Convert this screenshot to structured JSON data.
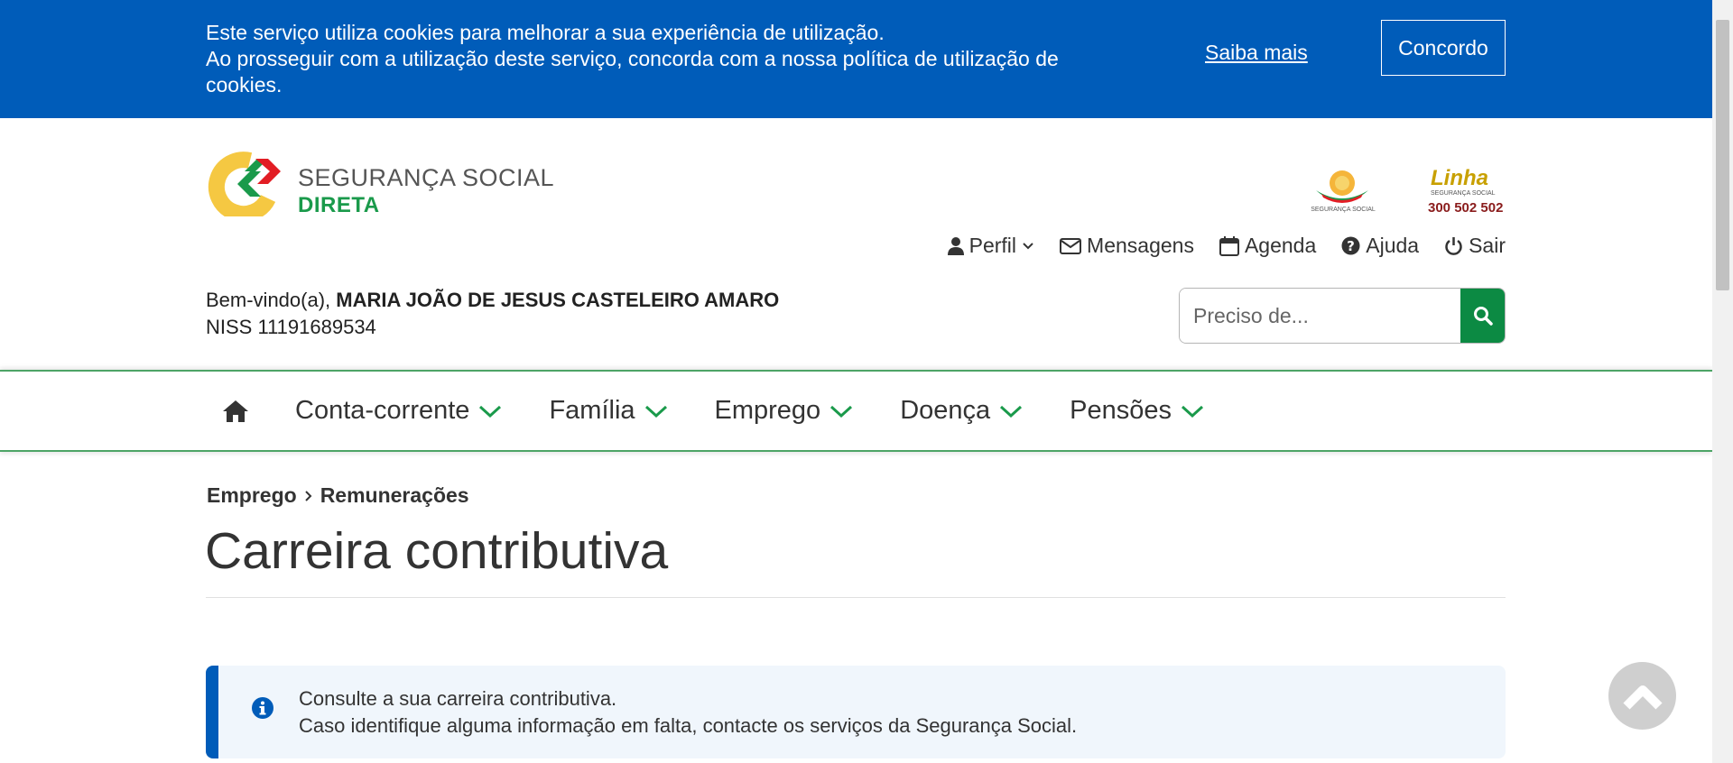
{
  "cookie": {
    "line1": "Este serviço utiliza cookies para melhorar a sua experiência de utilização.",
    "line2": "Ao prosseguir com a utilização deste serviço, concorda com a nossa política de utilização de",
    "line3": "cookies.",
    "more_label": "Saiba mais",
    "accept_label": "Concordo"
  },
  "header": {
    "logo_line1": "SEGURANÇA SOCIAL",
    "logo_line2": "DIRETA",
    "emblem_label": "SEGURANÇA SOCIAL",
    "linha_title": "Linha",
    "linha_sub": "SEGURANÇA SOCIAL",
    "linha_number": "300 502 502",
    "topnav": {
      "profile": "Perfil",
      "messages": "Mensagens",
      "agenda": "Agenda",
      "help": "Ajuda",
      "logout": "Sair"
    },
    "welcome_prefix": "Bem-vindo(a), ",
    "user_name": "MARIA JOÃO DE JESUS CASTELEIRO AMARO",
    "niss_label": "NISS 11191689534",
    "search_placeholder": "Preciso de..."
  },
  "mainnav": {
    "items": [
      {
        "label": "Conta-corrente"
      },
      {
        "label": "Família"
      },
      {
        "label": "Emprego"
      },
      {
        "label": "Doença"
      },
      {
        "label": "Pensões"
      }
    ]
  },
  "content": {
    "breadcrumb": [
      "Emprego",
      "Remunerações"
    ],
    "title": "Carreira contributiva",
    "info_line1": "Consulte a sua carreira contributiva.",
    "info_line2": "Caso identifique alguma informação em falta, contacte os serviços da Segurança Social."
  },
  "colors": {
    "brand_blue": "#005cb9",
    "brand_green": "#0c8a43",
    "nav_green": "#4da466"
  }
}
